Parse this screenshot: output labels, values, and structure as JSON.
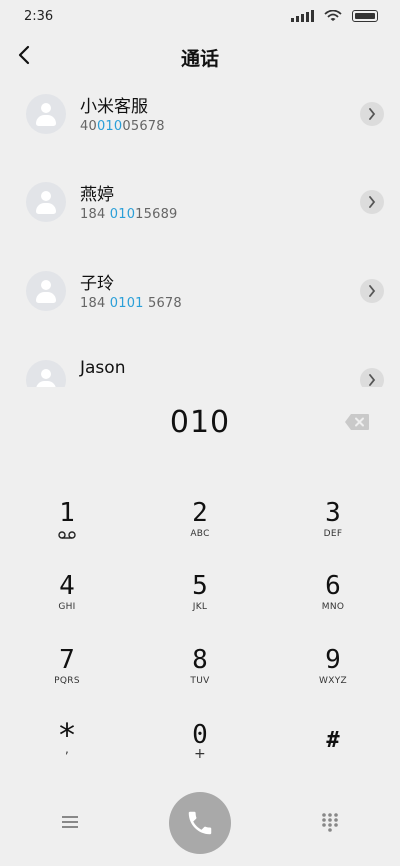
{
  "status_bar": {
    "time": "2:36"
  },
  "header": {
    "title": "通话"
  },
  "contacts": [
    {
      "name": "小米客服",
      "number_parts": [
        "40",
        "010",
        "05678"
      ]
    },
    {
      "name": "燕婷",
      "number_parts": [
        "184 ",
        "010",
        "15689"
      ]
    },
    {
      "name": "子玲",
      "number_parts": [
        "184 ",
        "0101",
        " 5678"
      ]
    },
    {
      "name": "Jason",
      "number_parts": [
        "",
        "",
        ""
      ]
    }
  ],
  "dialer": {
    "input_value": "010"
  },
  "keypad": {
    "keys": [
      {
        "digit": "1",
        "letters": ""
      },
      {
        "digit": "2",
        "letters": "ABC"
      },
      {
        "digit": "3",
        "letters": "DEF"
      },
      {
        "digit": "4",
        "letters": "GHI"
      },
      {
        "digit": "5",
        "letters": "JKL"
      },
      {
        "digit": "6",
        "letters": "MNO"
      },
      {
        "digit": "7",
        "letters": "PQRS"
      },
      {
        "digit": "8",
        "letters": "TUV"
      },
      {
        "digit": "9",
        "letters": "WXYZ"
      },
      {
        "digit": "*",
        "letters": ","
      },
      {
        "digit": "0",
        "letters": "+"
      },
      {
        "digit": "#",
        "letters": ""
      }
    ]
  },
  "colors": {
    "highlight": "#2a9fd8",
    "call_button": "#a9a9a9",
    "background": "#efefef"
  },
  "icons": {
    "back": "chevron-left-icon",
    "chevron": "chevron-right-icon",
    "backspace": "backspace-icon",
    "voicemail": "voicemail-icon",
    "menu": "menu-icon",
    "call": "phone-icon",
    "dialpad": "dialpad-icon"
  }
}
